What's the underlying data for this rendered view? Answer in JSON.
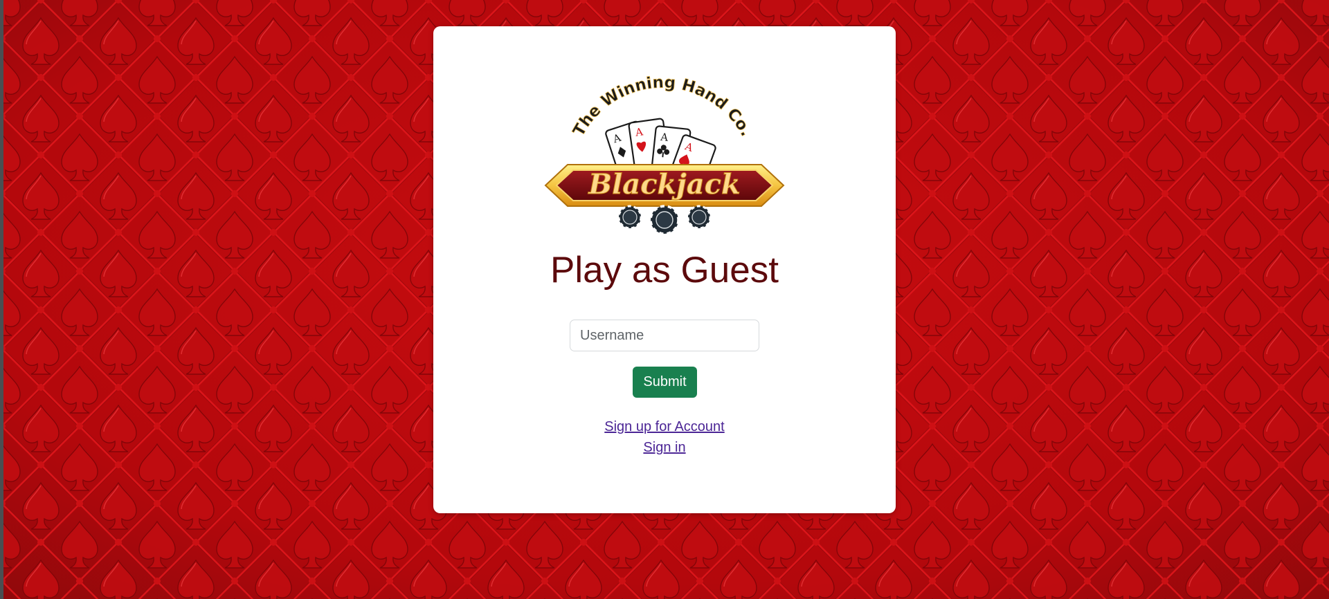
{
  "brand": {
    "tagline": "The Winning Hand Co.",
    "name": "Blackjack",
    "card_rank": "A"
  },
  "heading": "Play as Guest",
  "form": {
    "username_placeholder": "Username",
    "username_value": "",
    "submit_label": "Submit"
  },
  "links": {
    "signup": "Sign up for Account",
    "signin": "Sign in"
  },
  "colors": {
    "background": "#b3080c",
    "heading": "#5c0a0c",
    "submit": "#19804f",
    "link": "#4b2595",
    "logo_banner": "#7a0e12",
    "logo_gold": "#f5c542"
  },
  "icons": [
    "spade-pattern-background",
    "playing-cards-icon",
    "poker-chip-icon"
  ]
}
